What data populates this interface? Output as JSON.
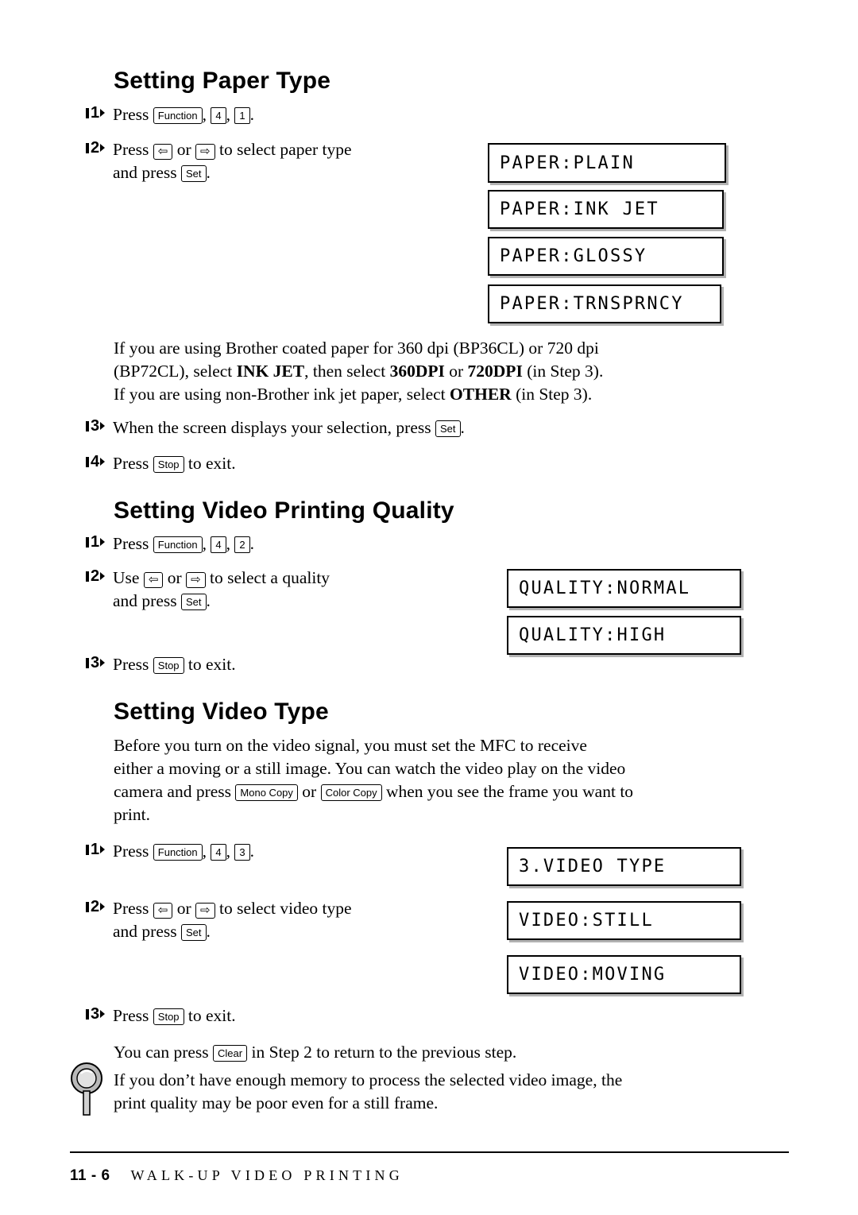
{
  "sections": [
    {
      "title": "Setting Paper Type",
      "steps": [
        {
          "num": "1",
          "text_before": "Press ",
          "keys": [
            "Function",
            "4",
            "1"
          ]
        },
        {
          "num": "2",
          "line1": "Press ",
          "line1b": " or ",
          "line1c": " to select paper type",
          "line2a": "and press ",
          "line2b": "."
        },
        {
          "num": "3",
          "text": "When the screen displays your selection, press "
        },
        {
          "num": "4",
          "text": "Press ",
          "text2": " to exit."
        }
      ],
      "lcds": [
        "PAPER:PLAIN",
        "PAPER:INK JET",
        "PAPER:GLOSSY",
        "PAPER:TRNSPRNCY"
      ],
      "paragraph": {
        "l1a": "If you are using Brother coated paper for 360 dpi (BP36CL) or 720 dpi",
        "l2a": "(BP72CL), select ",
        "l2b": "INK JET",
        "l2c": ", then select ",
        "l2d": "360DPI",
        "l2e": " or ",
        "l2f": "720DPI",
        "l2g": " (in Step 3).",
        "l3a": "If you are using non-Brother ink jet paper, select ",
        "l3b": "OTHER",
        "l3c": " (in Step 3)."
      }
    },
    {
      "title": "Setting Video Printing Quality",
      "steps": [
        {
          "num": "1",
          "text_before": "Press ",
          "keys": [
            "Function",
            "4",
            "2"
          ]
        },
        {
          "num": "2",
          "line1": "Use ",
          "line1b": " or ",
          "line1c": " to select a quality",
          "line2a": "and press ",
          "line2b": "."
        },
        {
          "num": "3",
          "text": "Press ",
          "text2": " to exit."
        }
      ],
      "lcds": [
        "QUALITY:NORMAL",
        "QUALITY:HIGH"
      ]
    },
    {
      "title": "Setting Video Type",
      "intro": {
        "l1": "Before you turn on the video signal, you must set the MFC to receive",
        "l2": "either a moving or a still image. You can watch the video play on the video",
        "l3a": "camera and press ",
        "l3b": " or ",
        "l3c": " when you see the frame you want to",
        "l4": "print."
      },
      "steps": [
        {
          "num": "1",
          "text_before": "Press ",
          "keys": [
            "Function",
            "4",
            "3"
          ]
        },
        {
          "num": "2",
          "line1": "Press ",
          "line1b": " or ",
          "line1c": " to select video type",
          "line2a": "and press ",
          "line2b": "."
        },
        {
          "num": "3",
          "text": "Press ",
          "text2": " to exit."
        }
      ],
      "lcds": [
        "3.VIDEO TYPE",
        "VIDEO:STILL",
        "VIDEO:MOVING"
      ],
      "after": {
        "a": "You can press ",
        "b": " in Step 2 to return to the previous step."
      }
    }
  ],
  "note": {
    "l1": "If you don’t have enough memory to process the selected video image, the",
    "l2": "print quality may be poor even for a still frame."
  },
  "keys": {
    "function": "Function",
    "set": "Set",
    "stop": "Stop",
    "clear": "Clear",
    "mono_copy": "Mono Copy",
    "color_copy": "Color Copy",
    "num4": "4",
    "num1": "1",
    "num2": "2",
    "num3": "3",
    "left_arrow": "⇦",
    "right_arrow": "⇨"
  },
  "footer": {
    "page": "11 - 6",
    "chapter": "WALK-UP VIDEO PRINTING"
  }
}
